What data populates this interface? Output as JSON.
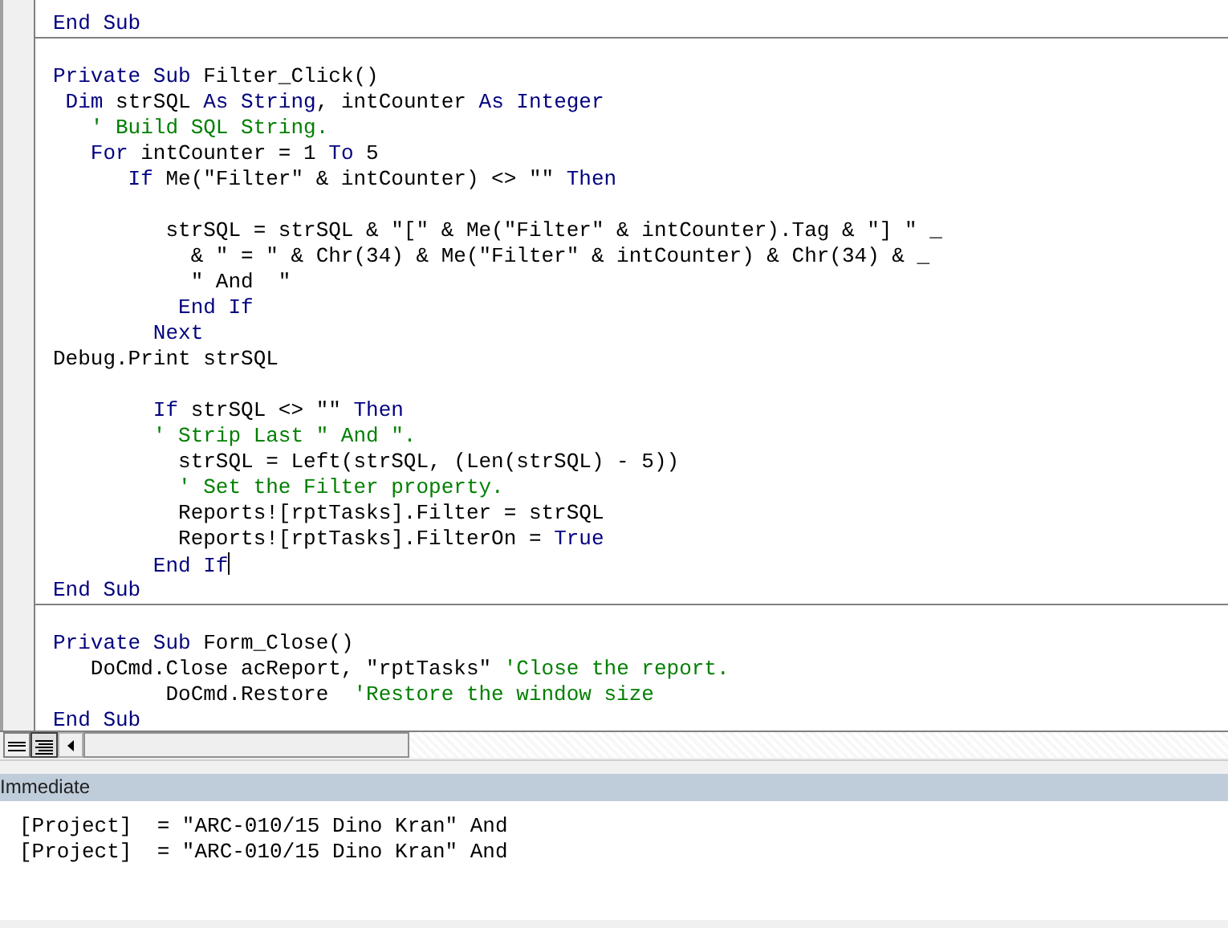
{
  "code_window": {
    "sections": [
      {
        "lines": [
          {
            "gap_before": false,
            "cursor": false,
            "segments": [
              {
                "kind": "keyword",
                "text": "End Sub"
              }
            ]
          }
        ]
      },
      {
        "lines": [
          {
            "gap_before": true,
            "cursor": false,
            "segments": [
              {
                "kind": "keyword",
                "text": "Private Sub "
              },
              {
                "kind": "plain",
                "text": "Filter_Click()"
              }
            ]
          },
          {
            "gap_before": false,
            "cursor": false,
            "segments": [
              {
                "kind": "keyword",
                "text": " Dim "
              },
              {
                "kind": "plain",
                "text": "strSQL "
              },
              {
                "kind": "keyword",
                "text": "As String"
              },
              {
                "kind": "plain",
                "text": ", intCounter "
              },
              {
                "kind": "keyword",
                "text": "As Integer"
              }
            ]
          },
          {
            "gap_before": false,
            "cursor": false,
            "segments": [
              {
                "kind": "comment",
                "text": "   ' Build SQL String."
              }
            ]
          },
          {
            "gap_before": false,
            "cursor": false,
            "segments": [
              {
                "kind": "keyword",
                "text": "   For "
              },
              {
                "kind": "plain",
                "text": "intCounter = 1 "
              },
              {
                "kind": "keyword",
                "text": "To "
              },
              {
                "kind": "plain",
                "text": "5"
              }
            ]
          },
          {
            "gap_before": false,
            "cursor": false,
            "segments": [
              {
                "kind": "keyword",
                "text": "      If "
              },
              {
                "kind": "plain",
                "text": "Me(\"Filter\" & intCounter) <> \"\" "
              },
              {
                "kind": "keyword",
                "text": "Then"
              }
            ]
          },
          {
            "gap_before": true,
            "cursor": false,
            "segments": [
              {
                "kind": "plain",
                "text": "         strSQL = strSQL & \"[\" & Me(\"Filter\" & intCounter).Tag & \"] \" _"
              }
            ]
          },
          {
            "gap_before": false,
            "cursor": false,
            "segments": [
              {
                "kind": "plain",
                "text": "           & \" = \" & Chr(34) & Me(\"Filter\" & intCounter) & Chr(34) & _"
              }
            ]
          },
          {
            "gap_before": false,
            "cursor": false,
            "segments": [
              {
                "kind": "plain",
                "text": "           \" And  \""
              }
            ]
          },
          {
            "gap_before": false,
            "cursor": false,
            "segments": [
              {
                "kind": "keyword",
                "text": "          End If"
              }
            ]
          },
          {
            "gap_before": false,
            "cursor": false,
            "segments": [
              {
                "kind": "keyword",
                "text": "        Next"
              }
            ]
          },
          {
            "gap_before": false,
            "cursor": false,
            "segments": [
              {
                "kind": "plain",
                "text": "Debug.Print strSQL"
              }
            ]
          },
          {
            "gap_before": true,
            "cursor": false,
            "segments": [
              {
                "kind": "keyword",
                "text": "        If "
              },
              {
                "kind": "plain",
                "text": "strSQL <> \"\" "
              },
              {
                "kind": "keyword",
                "text": "Then"
              }
            ]
          },
          {
            "gap_before": false,
            "cursor": false,
            "segments": [
              {
                "kind": "comment",
                "text": "        ' Strip Last \" And \"."
              }
            ]
          },
          {
            "gap_before": false,
            "cursor": false,
            "segments": [
              {
                "kind": "plain",
                "text": "          strSQL = Left(strSQL, (Len(strSQL) - 5))"
              }
            ]
          },
          {
            "gap_before": false,
            "cursor": false,
            "segments": [
              {
                "kind": "comment",
                "text": "          ' Set the Filter property."
              }
            ]
          },
          {
            "gap_before": false,
            "cursor": false,
            "segments": [
              {
                "kind": "plain",
                "text": "          Reports![rptTasks].Filter = strSQL"
              }
            ]
          },
          {
            "gap_before": false,
            "cursor": false,
            "segments": [
              {
                "kind": "plain",
                "text": "          Reports![rptTasks].FilterOn = "
              },
              {
                "kind": "keyword",
                "text": "True"
              }
            ]
          },
          {
            "gap_before": false,
            "cursor": true,
            "segments": [
              {
                "kind": "keyword",
                "text": "        End If"
              }
            ]
          },
          {
            "gap_before": false,
            "cursor": false,
            "segments": [
              {
                "kind": "keyword",
                "text": "End Sub"
              }
            ]
          }
        ]
      },
      {
        "lines": [
          {
            "gap_before": true,
            "cursor": false,
            "segments": [
              {
                "kind": "keyword",
                "text": "Private Sub "
              },
              {
                "kind": "plain",
                "text": "Form_Close()"
              }
            ]
          },
          {
            "gap_before": false,
            "cursor": false,
            "segments": [
              {
                "kind": "plain",
                "text": "   DoCmd.Close acReport, \"rptTasks\" "
              },
              {
                "kind": "comment",
                "text": "'Close the report."
              }
            ]
          },
          {
            "gap_before": false,
            "cursor": false,
            "segments": [
              {
                "kind": "plain",
                "text": "         DoCmd.Restore  "
              },
              {
                "kind": "comment",
                "text": "'Restore the window size"
              }
            ]
          },
          {
            "gap_before": false,
            "cursor": false,
            "segments": [
              {
                "kind": "keyword",
                "text": "End Sub"
              }
            ]
          }
        ]
      }
    ],
    "view_buttons": [
      {
        "kind": "procedure",
        "selected": false
      },
      {
        "kind": "module",
        "selected": true
      }
    ]
  },
  "immediate": {
    "title": "Immediate",
    "lines": [
      "[Project]  = \"ARC-010/15 Dino Kran\" And",
      "[Project]  = \"ARC-010/15 Dino Kran\" And"
    ]
  }
}
